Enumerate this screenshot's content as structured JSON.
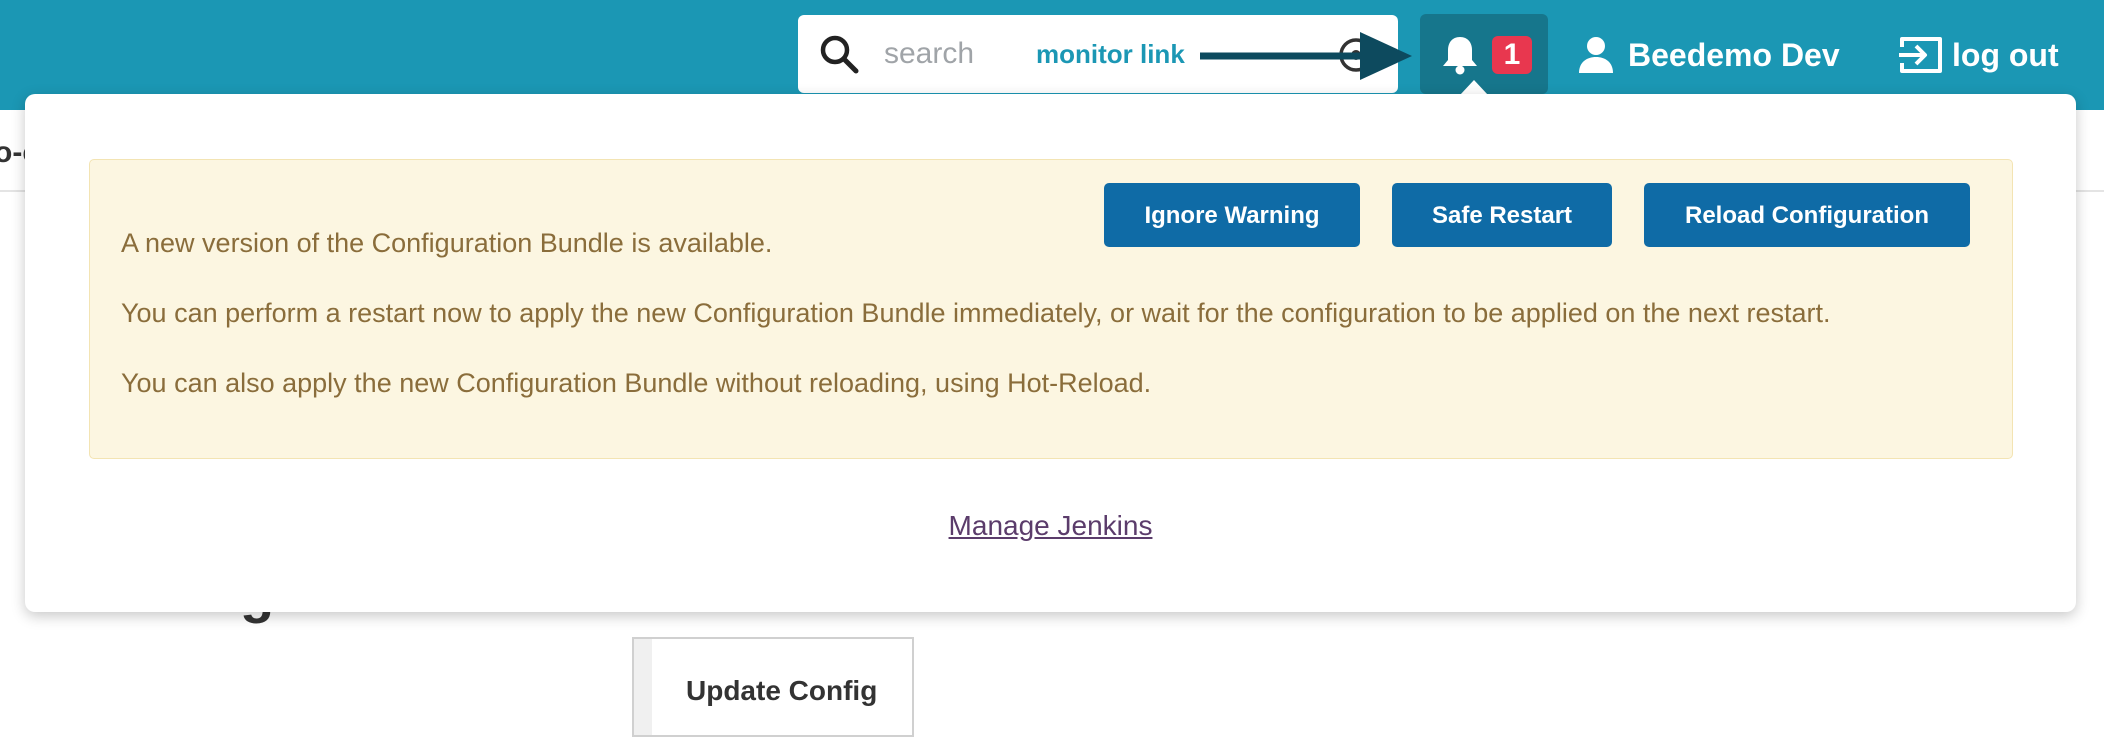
{
  "header": {
    "search": {
      "placeholder": "search",
      "monitor_link": "monitor link"
    },
    "notifications": {
      "badge_count": "1"
    },
    "user_name": "Beedemo Dev",
    "logout_label": "log out"
  },
  "page": {
    "left_fragment": "o-c",
    "heading_fragment": "g",
    "update_config_label": "Update Config"
  },
  "popover": {
    "alert_lines": [
      "A new version of the Configuration Bundle is available.",
      "You can perform a restart now to apply the new Configuration Bundle immediately, or wait for the configuration to be applied on the next restart.",
      "You can also apply the new Configuration Bundle without reloading, using Hot-Reload."
    ],
    "buttons": {
      "ignore": "Ignore Warning",
      "safe_restart": "Safe Restart",
      "reload": "Reload Configuration"
    },
    "manage_link": "Manage Jenkins"
  },
  "colors": {
    "header_bg": "#1b97b4",
    "bell_bg": "#16768c",
    "badge_bg": "#e8374f",
    "button_bg": "#0f6ba6",
    "alert_bg": "#fcf6e1",
    "alert_text": "#8a6d3b",
    "annotation_arrow": "#0d4a5e"
  }
}
